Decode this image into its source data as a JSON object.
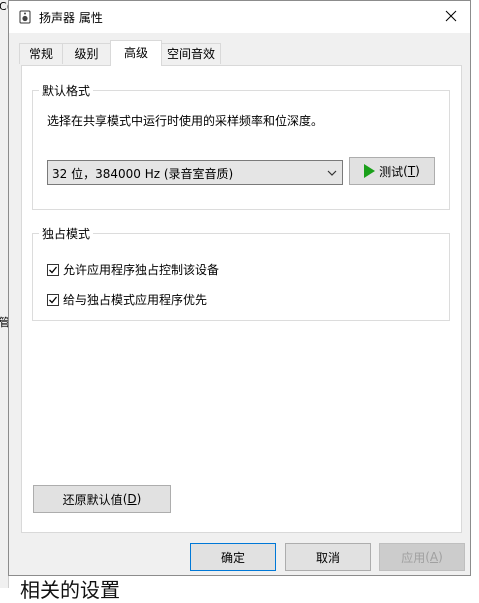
{
  "background": {
    "frag_c": "C(",
    "frag_g": "管",
    "bottom_text": "相关的设置"
  },
  "dialog": {
    "title": "扬声器 属性",
    "close_label": "✕"
  },
  "tabs": [
    {
      "label": "常规",
      "active": false
    },
    {
      "label": "级别",
      "active": false
    },
    {
      "label": "高级",
      "active": true
    },
    {
      "label": "空间音效",
      "active": false
    }
  ],
  "default_format": {
    "title": "默认格式",
    "description": "选择在共享模式中运行时使用的采样频率和位深度。",
    "selected_format": "32 位，384000 Hz (录音室音质)",
    "test_button": {
      "label": "测试",
      "accel": "T"
    }
  },
  "exclusive_mode": {
    "title": "独占模式",
    "options": [
      {
        "label": "允许应用程序独占控制该设备",
        "checked": true
      },
      {
        "label": "给与独占模式应用程序优先",
        "checked": true
      }
    ]
  },
  "restore_defaults": {
    "label": "还原默认值",
    "accel": "D"
  },
  "footer": {
    "ok": "确定",
    "cancel": "取消",
    "apply": {
      "label": "应用",
      "accel": "A"
    }
  },
  "colors": {
    "accent": "#0078d7",
    "play_icon": "#1aa01a",
    "dialog_bg": "#f0f0f0"
  }
}
